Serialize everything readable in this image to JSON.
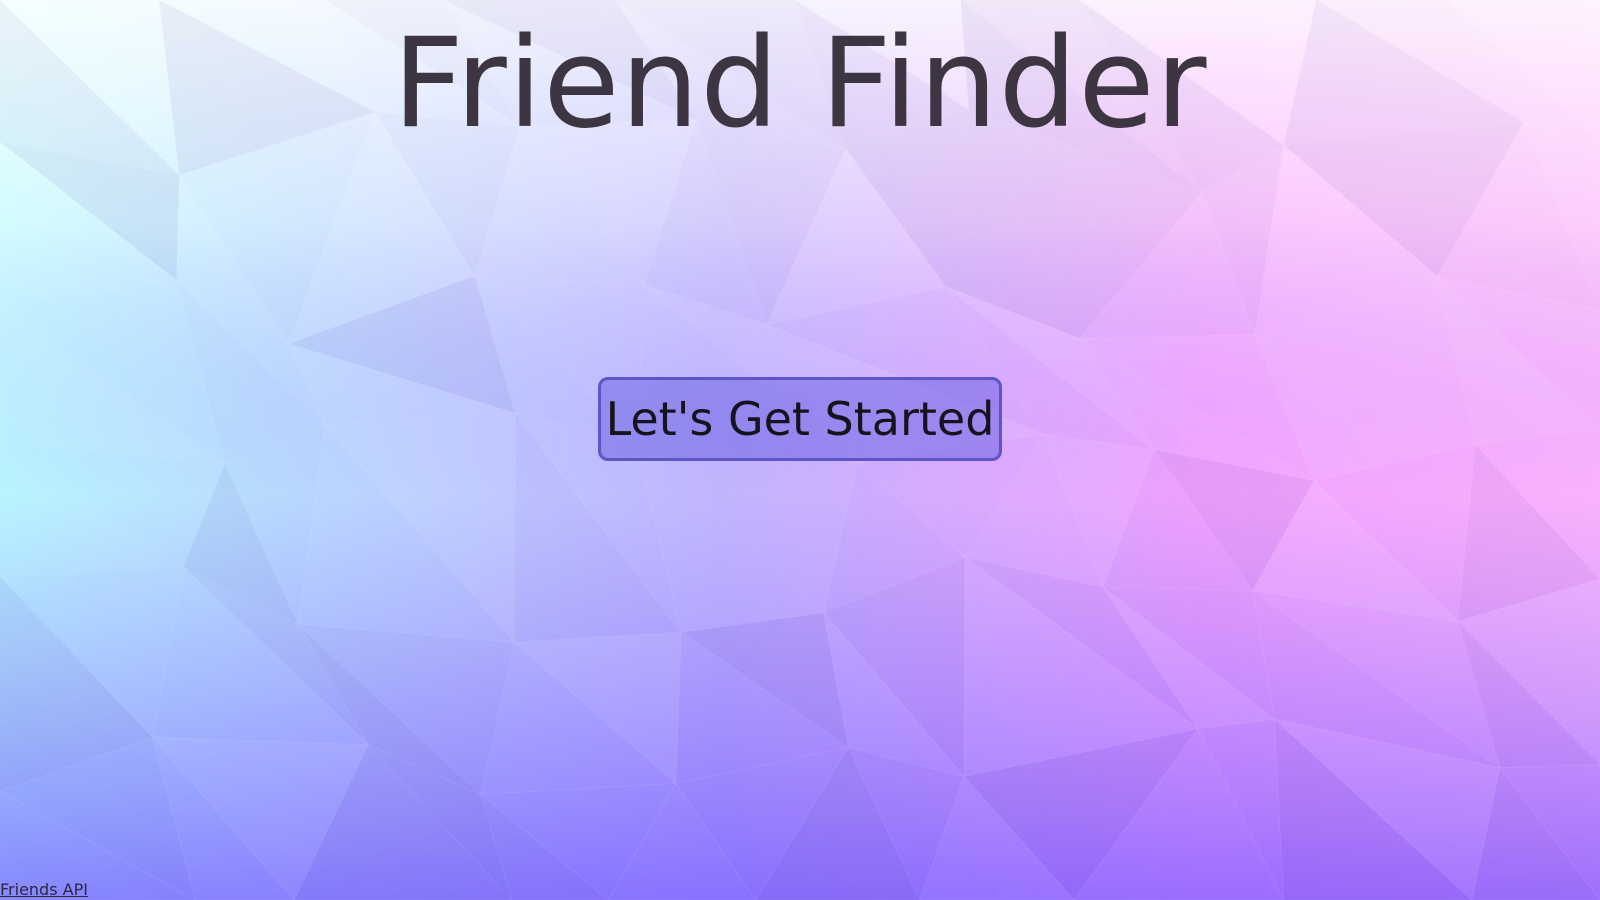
{
  "page": {
    "title": "Friend Finder",
    "start_button_label": "Let's Get Started",
    "footer_link_label": "Friends API"
  },
  "colors": {
    "background_top_left": "#e8ffff",
    "background_left": "#b3f6ff",
    "background_bottom_left": "#78b4ff",
    "background_bottom_center": "#7a62ff",
    "background_bottom_right": "#c84cf5",
    "background_right": "#ff9cfb",
    "background_top_right": "#ffe6ff",
    "title_text": "#3d3541",
    "button_fill": "#8e86e5",
    "button_border": "#5e56c6"
  },
  "icons": {
    "background": "low-poly-pattern"
  }
}
